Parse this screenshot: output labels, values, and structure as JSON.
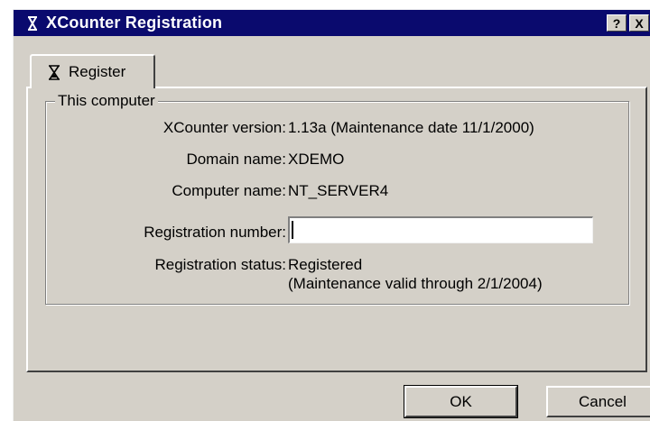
{
  "window": {
    "title": "XCounter Registration",
    "help_label": "?",
    "close_label": "X",
    "app_icon": "hourglass-icon"
  },
  "tab": {
    "label": "Register",
    "icon": "hourglass-icon"
  },
  "group": {
    "title": "This computer",
    "fields": [
      {
        "label": "XCounter version:",
        "value": "1.13a (Maintenance date 11/1/2000)"
      },
      {
        "label": "Domain name:",
        "value": "XDEMO"
      },
      {
        "label": "Computer name:",
        "value": "NT_SERVER4"
      },
      {
        "label": "Registration number:",
        "value": ""
      },
      {
        "label": "Registration status:",
        "value": "Registered",
        "value2": "(Maintenance valid through 2/1/2004)"
      }
    ]
  },
  "buttons": {
    "ok": "OK",
    "cancel": "Cancel"
  },
  "colors": {
    "titlebar": "#0a0a6e",
    "face": "#d4d0c8"
  }
}
